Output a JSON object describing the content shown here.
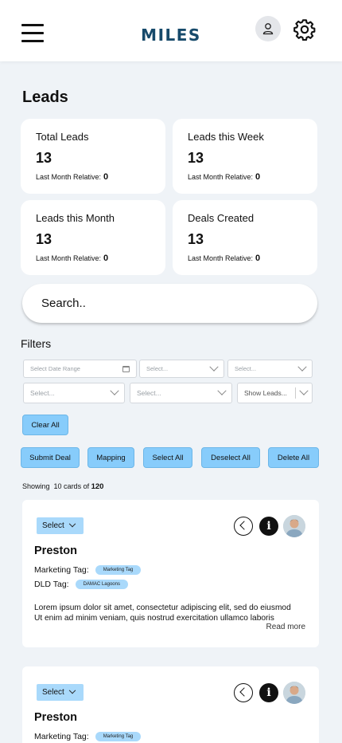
{
  "header": {
    "logo": "MILES",
    "icons": {
      "menu": "hamburger-menu-icon",
      "user": "user-icon",
      "settings": "gear-icon"
    }
  },
  "page": {
    "title": "Leads"
  },
  "stats": [
    {
      "label": "Total Leads",
      "value": "13",
      "sub_label": "Last Month Relative:",
      "sub_value": "0"
    },
    {
      "label": "Leads this Week",
      "value": "13",
      "sub_label": "Last Month Relative:",
      "sub_value": "0"
    },
    {
      "label": "Leads this Month",
      "value": "13",
      "sub_label": "Last Month Relative:",
      "sub_value": "0"
    },
    {
      "label": "Deals Created",
      "value": "13",
      "sub_label": "Last Month Relative:",
      "sub_value": "0"
    }
  ],
  "search": {
    "placeholder": "Search.."
  },
  "filters": {
    "label": "Filters",
    "date_range_placeholder": "Select Date Range",
    "select_placeholder": "Select...",
    "show_leads_placeholder": "Show Leads..."
  },
  "buttons": {
    "clear_all": "Clear All",
    "submit_deal": "Submit Deal",
    "mapping": "Mapping",
    "select_all": "Select All",
    "deselect_all": "Deselect All",
    "delete_all": "Delete All"
  },
  "showing": {
    "prefix": "Showing",
    "count_text": "10 cards of",
    "total": "120"
  },
  "leads": [
    {
      "select_label": "Select",
      "name": "Preston",
      "marketing_tag_label": "Marketing Tag:",
      "marketing_tag": "Marketing Tag",
      "dld_tag_label": "DLD Tag:",
      "dld_tag": "DAMAC Lagoons",
      "description_line1": "Lorem ipsum dolor sit amet, consectetur adipiscing elit, sed do eiusmod",
      "description_line2": "Ut enim ad minim veniam, quis nostrud exercitation ullamco laboris",
      "read_more": "Read more"
    },
    {
      "select_label": "Select",
      "name": "Preston",
      "marketing_tag_label": "Marketing Tag:",
      "marketing_tag": "Marketing Tag"
    }
  ],
  "colors": {
    "brand": "#174a6b",
    "accent": "#87ccfb",
    "page_bg": "#eff3f7"
  }
}
